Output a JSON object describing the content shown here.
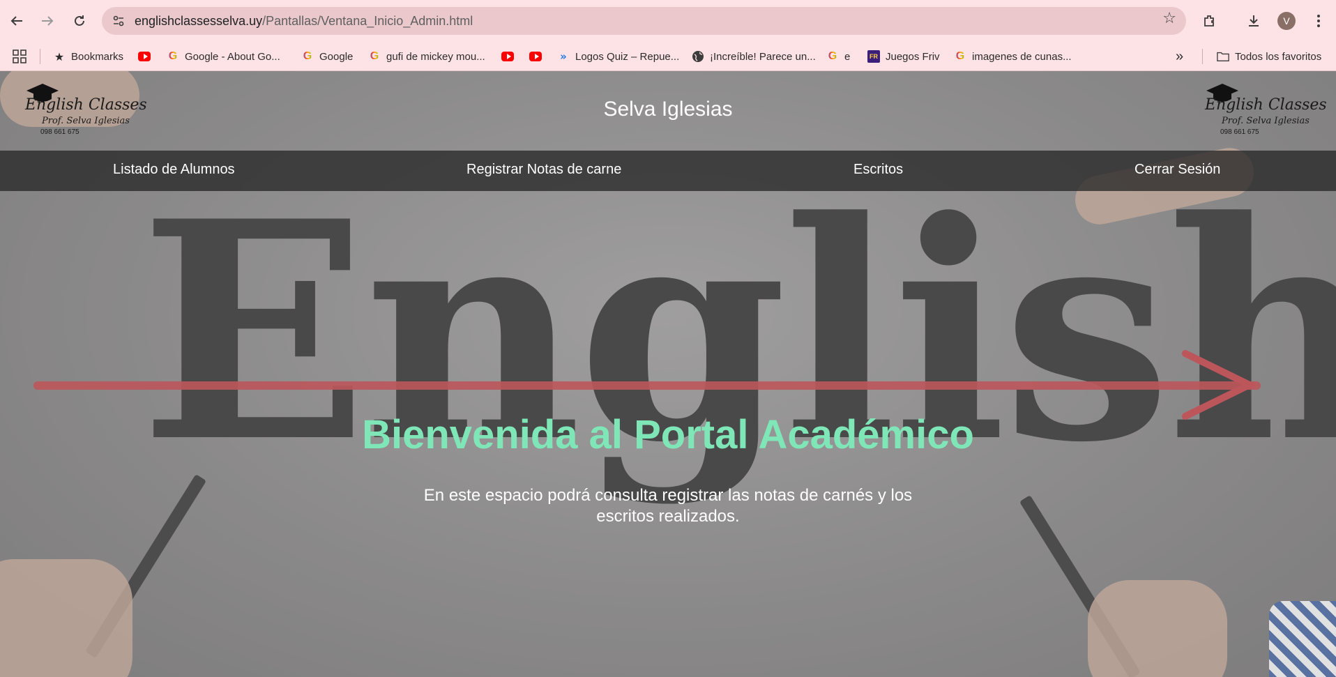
{
  "browser": {
    "url_host": "englishclassesselva.uy",
    "url_path": "/Pantallas/Ventana_Inicio_Admin.html",
    "profile_initial": "V",
    "bookmarks": [
      {
        "label": "Bookmarks",
        "icon": "star-icon"
      },
      {
        "label": "",
        "icon": "youtube-icon"
      },
      {
        "label": "Google - About Go...",
        "icon": "google-icon"
      },
      {
        "label": "Google",
        "icon": "google-icon"
      },
      {
        "label": "gufi de mickey mou...",
        "icon": "google-icon"
      },
      {
        "label": "",
        "icon": "youtube-icon"
      },
      {
        "label": "",
        "icon": "youtube-icon"
      },
      {
        "label": "Logos Quiz – Repue...",
        "icon": "chevrons-icon"
      },
      {
        "label": "¡Increíble! Parece un...",
        "icon": "globe-icon"
      },
      {
        "label": "e",
        "icon": "google-icon"
      },
      {
        "label": "Juegos Friv",
        "icon": "friv-icon"
      },
      {
        "label": "imagenes de cunas...",
        "icon": "google-icon"
      }
    ],
    "all_bookmarks_label": "Todos los favoritos"
  },
  "page": {
    "site_title": "Selva Iglesias",
    "logo": {
      "line1": "English Classes",
      "line2": "Prof. Selva Iglesias",
      "phone": "098 661 675"
    },
    "background_word": "English",
    "nav": {
      "students": "Listado de Alumnos",
      "grades": "Registrar Notas de carne",
      "writings": "Escritos",
      "logout": "Cerrar Sesión"
    },
    "welcome_title": "Bienvenida al Portal Académico",
    "intro_text": "En este espacio podrá consulta registrar las notas de carnés y los escritos realizados."
  },
  "colors": {
    "chrome_bg": "#fde3e6",
    "omnibox_bg": "#eac8cc",
    "welcome_title": "#7fe6b8",
    "navbar_bg": "#282828"
  }
}
